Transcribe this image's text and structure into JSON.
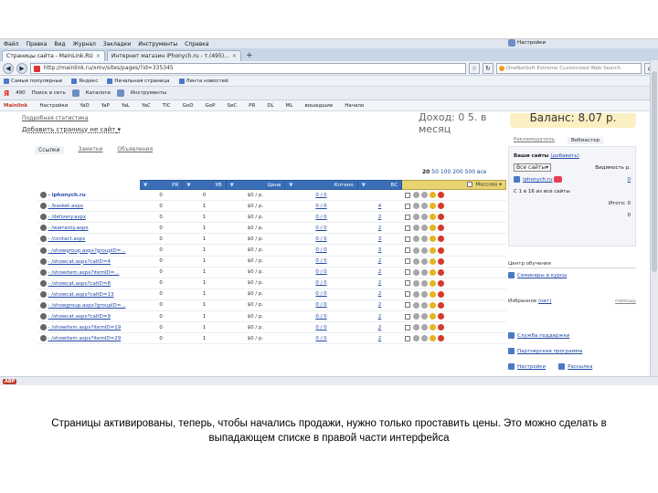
{
  "browser": {
    "menu": [
      "Файл",
      "Правка",
      "Вид",
      "Журнал",
      "Закладки",
      "Инструменты",
      "Справка"
    ],
    "tabs": [
      {
        "label": "Страницы сайта - MainLink.RU",
        "active": true
      },
      {
        "label": "Интернет магазин iPhonych.ru - т.(495)...",
        "active": false
      }
    ],
    "url": "http://mainlink.ru/xmv/sites/pages/?id=335345",
    "search_placeholder": "OneNetSoft Extreme Customized Web Search",
    "bookmarks": [
      "Самые популярные",
      "Яндекс",
      "Начальная страница",
      "Лента новостей"
    ],
    "toolbar2": {
      "count": "490",
      "find": "Поиск в сеть",
      "catalog": "Каталоги",
      "tools": "Инструменты",
      "settings": "Настройки"
    },
    "toolbar3": [
      "Mainlink",
      "Настройки",
      "YaD",
      "YaP",
      "YaL",
      "YaC",
      "TIC",
      "GoD",
      "GoP",
      "SeC",
      "PR",
      "DL",
      "ML",
      "вошедшие",
      "Начало"
    ],
    "status": "ABP"
  },
  "page": {
    "link_top": "Подробная статистика",
    "add_page": "Добавить страницу не сайт",
    "dohod": "Доход: 0 5. в месяц",
    "subtabs": [
      "Ссылки",
      "Заметки",
      "Объявления"
    ],
    "pagination": {
      "prefix": "20",
      "links": [
        "50",
        "100",
        "200",
        "500"
      ],
      "suffix": "все"
    },
    "table": {
      "columns": [
        "PR",
        "УВ",
        "Цена",
        "Клтено",
        "ВС",
        "Массово"
      ],
      "rows": [
        {
          "name": "iphonych.ru",
          "pr": "0",
          "uv": "0",
          "price": "$0 / р.",
          "kl": "0 / 0",
          "vs": "",
          "bold": true
        },
        {
          "name": "/basket.aspx",
          "pr": "0",
          "uv": "1",
          "price": "$0 / р.",
          "kl": "0 / 0",
          "vs": "4",
          "bold": false
        },
        {
          "name": "/delivery.aspx",
          "pr": "0",
          "uv": "1",
          "price": "$0 / р.",
          "kl": "0 / 0",
          "vs": "2",
          "bold": false
        },
        {
          "name": "/warranty.aspx",
          "pr": "0",
          "uv": "1",
          "price": "$0 / р.",
          "kl": "0 / 0",
          "vs": "2",
          "bold": false
        },
        {
          "name": "/contact.aspx",
          "pr": "0",
          "uv": "1",
          "price": "$0 / р.",
          "kl": "0 / 0",
          "vs": "3",
          "bold": false
        },
        {
          "name": "/showgroup.aspx?groupID=...",
          "pr": "0",
          "uv": "1",
          "price": "$0 / р.",
          "kl": "0 / 0",
          "vs": "3",
          "bold": false
        },
        {
          "name": "/showcat.aspx?catID=4",
          "pr": "0",
          "uv": "1",
          "price": "$0 / р.",
          "kl": "0 / 0",
          "vs": "2",
          "bold": false
        },
        {
          "name": "/showitem.aspx?itemID=...",
          "pr": "0",
          "uv": "1",
          "price": "$0 / р.",
          "kl": "0 / 0",
          "vs": "2",
          "bold": false
        },
        {
          "name": "/showcat.aspx?catID=8",
          "pr": "0",
          "uv": "1",
          "price": "$0 / р.",
          "kl": "0 / 0",
          "vs": "2",
          "bold": false
        },
        {
          "name": "/showcat.aspx?catID=13",
          "pr": "0",
          "uv": "1",
          "price": "$0 / р.",
          "kl": "0 / 0",
          "vs": "2",
          "bold": false
        },
        {
          "name": "/showgroup.aspx?groupID=...",
          "pr": "0",
          "uv": "1",
          "price": "$0 / р.",
          "kl": "0 / 0",
          "vs": "2",
          "bold": false
        },
        {
          "name": "/showcat.aspx?catID=9",
          "pr": "0",
          "uv": "1",
          "price": "$0 / р.",
          "kl": "0 / 0",
          "vs": "2",
          "bold": false
        },
        {
          "name": "/showitem.aspx?itemID=19",
          "pr": "0",
          "uv": "1",
          "price": "$0 / р.",
          "kl": "0 / 0",
          "vs": "2",
          "bold": false
        },
        {
          "name": "/showitem.aspx?itemID=29",
          "pr": "0",
          "uv": "1",
          "price": "$0 / р.",
          "kl": "0 / 0",
          "vs": "2",
          "bold": false
        }
      ]
    },
    "right": {
      "balance": "Баланс: 8.07 р.",
      "tabs": [
        "Рекламодатель",
        "Вебмастер"
      ],
      "sites_label": "Ваши сайты",
      "sites_link": "(добавить)",
      "select_value": "Все сайты",
      "visible_label": "Видимость р.",
      "visible_val": "0",
      "site_name": "iphonych.ru",
      "site_val": "0",
      "range": "С 1 в 16 из все сайты",
      "total": "Итого: 0",
      "learning": "Центр обучения",
      "seminars": "Семинары и курсы",
      "favorites": "Избранное",
      "fav_link": "(нет)",
      "help": "помощь",
      "menu": [
        "Служба поддержки",
        "Партнерская программа",
        "Настройки",
        "Рассылка"
      ]
    }
  },
  "caption": "Страницы активированы, теперь, чтобы начались продажи, нужно только проставить цены. Это можно сделать в выпадающем списке в правой части интерфейса"
}
